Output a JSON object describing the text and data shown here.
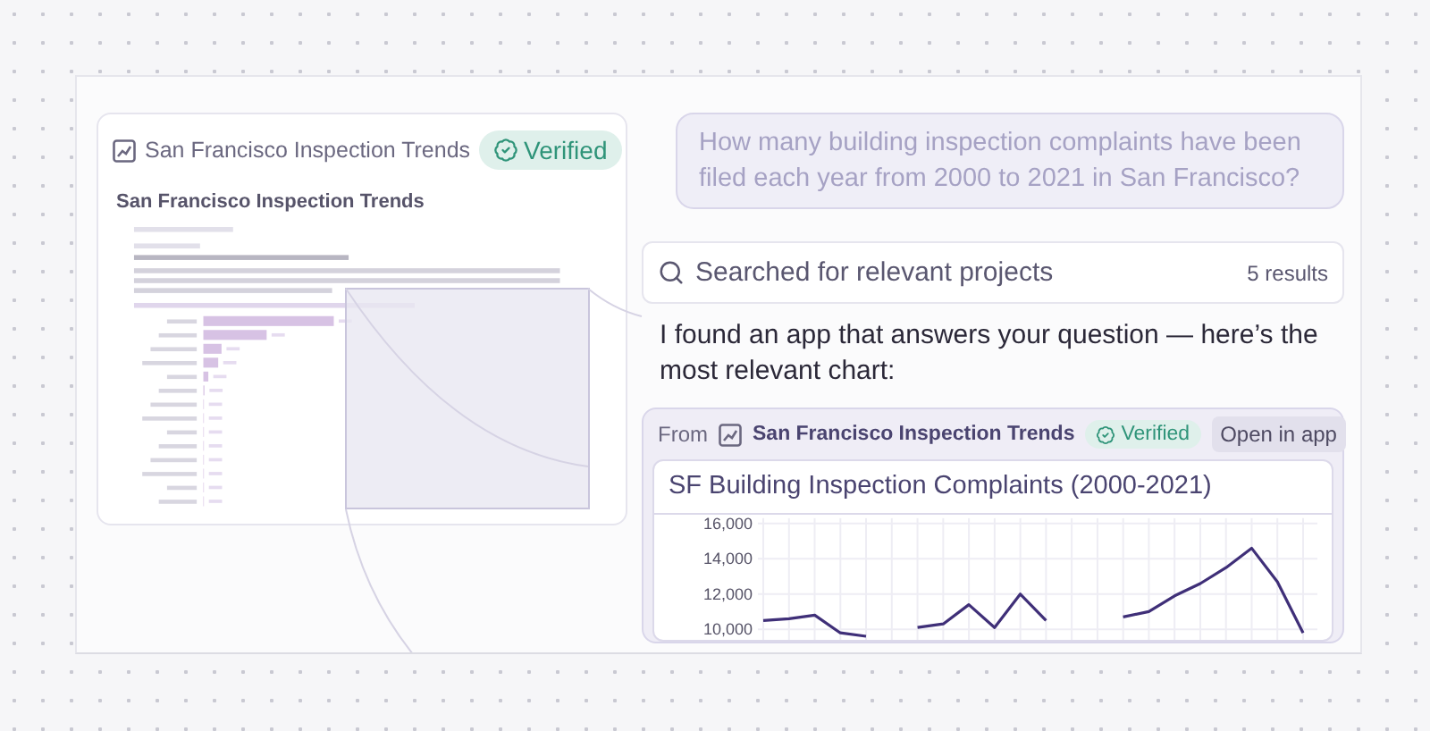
{
  "document_card": {
    "title": "San Francisco Inspection Trends",
    "badge": "Verified",
    "preview_heading": "San Francisco Inspection Trends"
  },
  "question": "How many building inspection complaints have been filed each year from 2000 to 2021 in San Francisco?",
  "search": {
    "label": "Searched for relevant projects",
    "count": "5 results"
  },
  "answer": "I found an app that answers your question — here’s the most relevant chart:",
  "result": {
    "from_label": "From",
    "app_name": "San Francisco Inspection Trends",
    "badge": "Verified",
    "open_button": "Open in app",
    "chart_data": {
      "type": "line",
      "title": "SF Building Inspection Complaints (2000-2021)",
      "grid": true,
      "series": [
        {
          "color": "#3f2f78",
          "values": [
            10500,
            10600,
            10800,
            9800,
            9600,
            null,
            10100,
            10300,
            11400,
            10100,
            12000,
            10500,
            null,
            null,
            10700,
            11000,
            11900,
            12600,
            13500,
            14600,
            12700,
            9800
          ]
        }
      ],
      "ylim": [
        9400,
        16500
      ],
      "yticks": [
        {
          "value": 10000,
          "label": "10,000"
        },
        {
          "value": 12000,
          "label": "12,000"
        },
        {
          "value": 14000,
          "label": "14,000"
        },
        {
          "value": 16000,
          "label": "16,000"
        }
      ]
    }
  }
}
